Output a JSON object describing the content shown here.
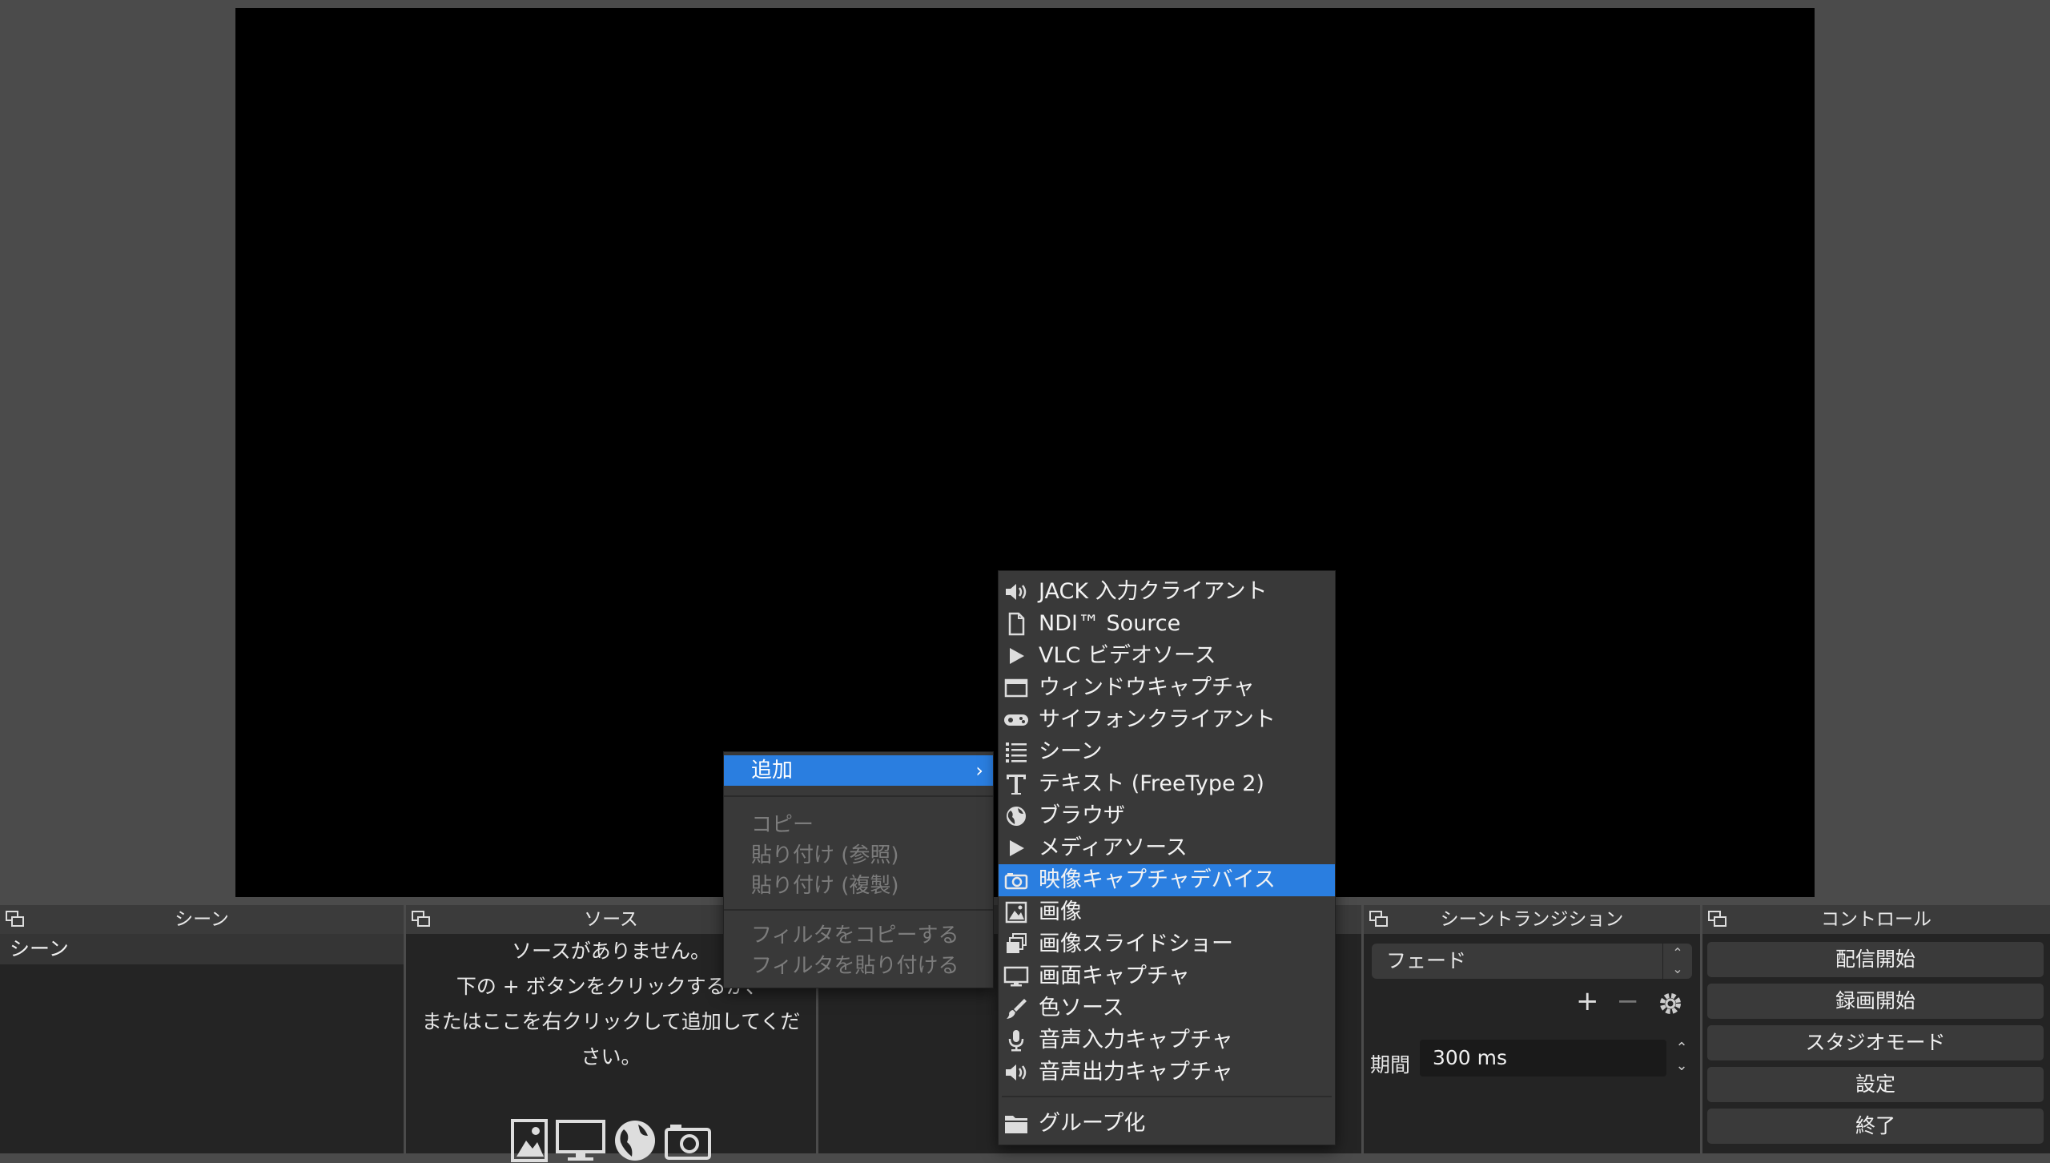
{
  "docks": {
    "scenes": {
      "title": "シーン",
      "items": [
        "シーン"
      ]
    },
    "sources": {
      "title": "ソース",
      "empty_lines": [
        "ソースがありません。",
        "下の + ボタンをクリックするか、",
        "またはここを右クリックして追加してくだ",
        "さい。"
      ],
      "icons": [
        "image-icon",
        "monitor-icon",
        "globe-icon",
        "camera-icon"
      ]
    },
    "transitions": {
      "title": "シーントランジション",
      "selected": "フェード",
      "duration_label": "期間",
      "duration_value": "300 ms"
    },
    "controls": {
      "title": "コントロール",
      "buttons": [
        "配信開始",
        "録画開始",
        "スタジオモード",
        "設定",
        "終了"
      ]
    }
  },
  "context_menu": {
    "add": "追加",
    "copy": "コピー",
    "paste_ref": "貼り付け (参照)",
    "paste_dup": "貼り付け (複製)",
    "copy_filters": "フィルタをコピーする",
    "paste_filters": "フィルタを貼り付ける"
  },
  "add_submenu": {
    "items": [
      {
        "label": "JACK 入力クライアント",
        "icon": "speaker-icon"
      },
      {
        "label": "NDI™ Source",
        "icon": "file-icon"
      },
      {
        "label": "VLC ビデオソース",
        "icon": "play-icon"
      },
      {
        "label": "ウィンドウキャプチャ",
        "icon": "window-icon"
      },
      {
        "label": "サイフォンクライアント",
        "icon": "gamepad-icon"
      },
      {
        "label": "シーン",
        "icon": "list-icon"
      },
      {
        "label": "テキスト (FreeType 2)",
        "icon": "text-icon"
      },
      {
        "label": "ブラウザ",
        "icon": "globe-icon"
      },
      {
        "label": "メディアソース",
        "icon": "play-icon"
      },
      {
        "label": "映像キャプチャデバイス",
        "icon": "camera-icon",
        "active": true
      },
      {
        "label": "画像",
        "icon": "image-icon"
      },
      {
        "label": "画像スライドショー",
        "icon": "slideshow-icon"
      },
      {
        "label": "画面キャプチャ",
        "icon": "monitor-icon"
      },
      {
        "label": "色ソース",
        "icon": "brush-icon"
      },
      {
        "label": "音声入力キャプチャ",
        "icon": "microphone-icon"
      },
      {
        "label": "音声出力キャプチャ",
        "icon": "speaker-icon"
      }
    ],
    "group": {
      "label": "グループ化",
      "icon": "folder-icon"
    }
  },
  "colors": {
    "accent": "#2a7ee0",
    "panel": "#242424",
    "menu": "#393939"
  }
}
